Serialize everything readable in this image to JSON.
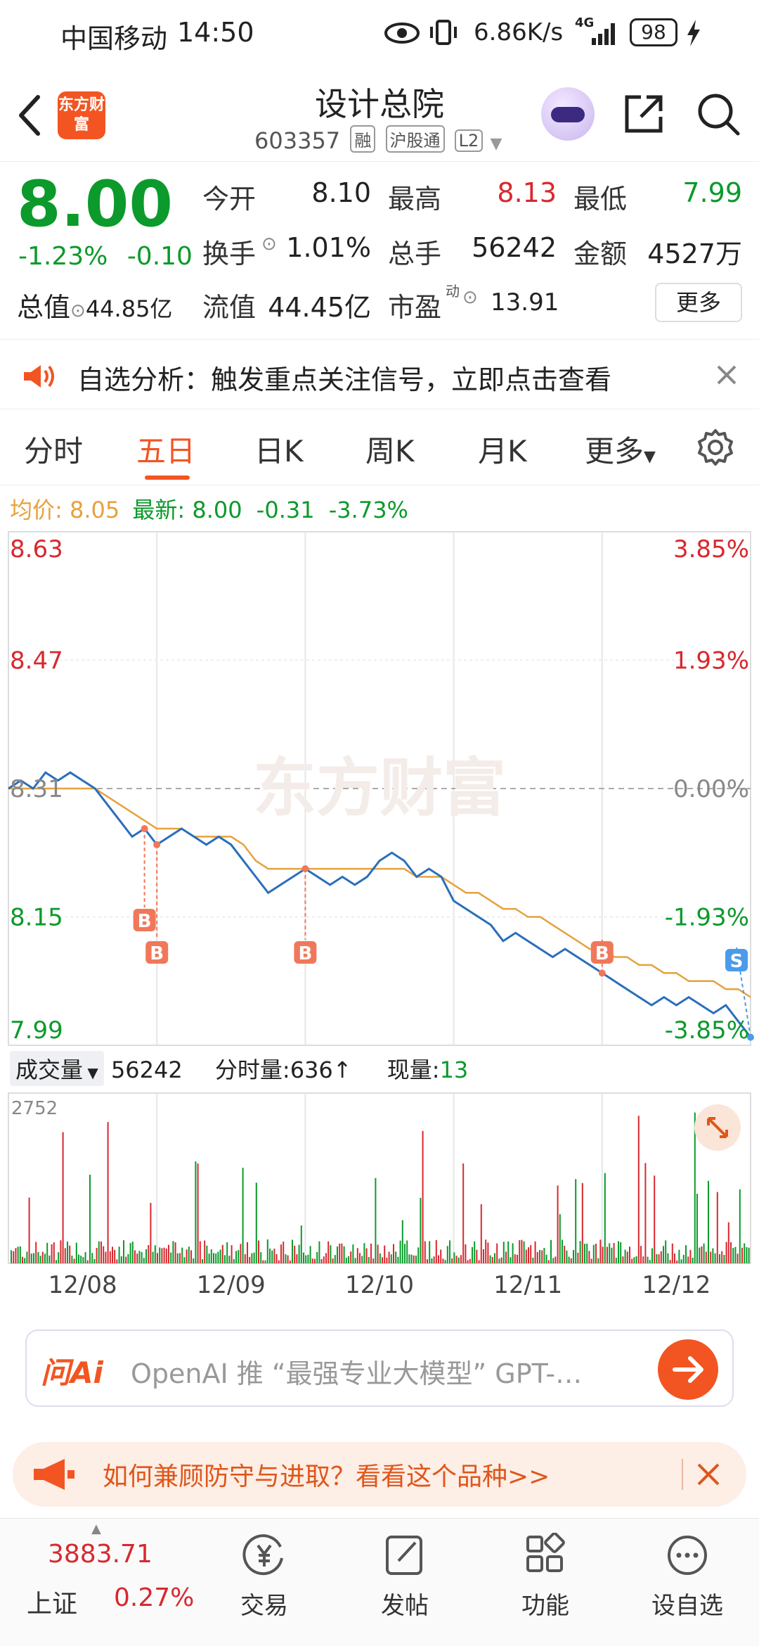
{
  "status_bar": {
    "carrier": "中国移动",
    "time": "14:50",
    "net_speed": "6.86K/s",
    "network": "4G",
    "battery": "98"
  },
  "header": {
    "logo_text": "东方财富",
    "title": "设计总院",
    "code": "603357",
    "tags": [
      "融",
      "沪股通",
      "L2"
    ]
  },
  "quote": {
    "price": "8.00",
    "change_pct": "-1.23%",
    "change": "-0.10",
    "open_label": "今开",
    "open": "8.10",
    "high_label": "最高",
    "high": "8.13",
    "low_label": "最低",
    "low": "7.99",
    "turnover_label": "换手",
    "turnover": "1.01%",
    "volume_label": "总手",
    "volume": "56242",
    "amount_label": "金额",
    "amount": "4527万",
    "total_cap_label": "总值",
    "total_cap": "44.85亿",
    "float_cap_label": "流值",
    "float_cap": "44.45亿",
    "pe_label": "市盈",
    "pe_sup": "动",
    "pe": "13.91",
    "more": "更多"
  },
  "notice": {
    "text": "自选分析：触发重点关注信号，立即点击查看"
  },
  "tabs": [
    "分时",
    "五日",
    "日K",
    "周K",
    "月K",
    "更多"
  ],
  "active_tab": 1,
  "legend": {
    "avg_label": "均价:",
    "avg": "8.05",
    "latest_label": "最新:",
    "latest": "8.00",
    "change": "-0.31",
    "change_pct": "-3.73%"
  },
  "colors": {
    "up": "#d8282e",
    "down": "#0b9a2b",
    "avg": "#e6a23c",
    "price": "#2a6ebb",
    "brand": "#f25522"
  },
  "watermark": "东方财富",
  "chart_data": {
    "type": "line",
    "title": "",
    "y_ticks_left": [
      "8.63",
      "8.47",
      "8.31",
      "8.15",
      "7.99"
    ],
    "y_ticks_right": [
      "3.85%",
      "1.93%",
      "0.00%",
      "-1.93%",
      "-3.85%"
    ],
    "ylim": [
      7.99,
      8.63
    ],
    "x_labels": [
      "12/08",
      "12/09",
      "12/10",
      "12/11",
      "12/12"
    ],
    "series": [
      {
        "values": [
          8.31,
          8.32,
          8.31,
          8.33,
          8.32,
          8.33,
          8.32,
          8.31,
          8.29,
          8.27,
          8.25,
          8.26,
          8.24,
          8.25,
          8.26,
          8.25,
          8.24,
          8.25,
          8.24,
          8.22,
          8.2,
          8.18,
          8.19,
          8.2,
          8.21,
          8.2,
          8.19,
          8.2,
          8.19,
          8.2,
          8.22,
          8.23,
          8.22,
          8.2,
          8.21,
          8.2,
          8.17,
          8.16,
          8.15,
          8.14,
          8.12,
          8.13,
          8.12,
          8.11,
          8.1,
          8.11,
          8.1,
          8.09,
          8.08,
          8.07,
          8.06,
          8.05,
          8.04,
          8.05,
          8.04,
          8.05,
          8.04,
          8.03,
          8.04,
          8.02,
          8.0
        ]
      },
      {
        "values": [
          8.31,
          8.31,
          8.31,
          8.31,
          8.31,
          8.31,
          8.31,
          8.31,
          8.3,
          8.29,
          8.28,
          8.27,
          8.26,
          8.26,
          8.26,
          8.25,
          8.25,
          8.25,
          8.25,
          8.24,
          8.22,
          8.21,
          8.21,
          8.21,
          8.21,
          8.21,
          8.21,
          8.21,
          8.21,
          8.21,
          8.21,
          8.21,
          8.21,
          8.2,
          8.2,
          8.2,
          8.19,
          8.18,
          8.18,
          8.17,
          8.16,
          8.16,
          8.15,
          8.15,
          8.14,
          8.13,
          8.12,
          8.11,
          8.11,
          8.1,
          8.1,
          8.09,
          8.09,
          8.08,
          8.08,
          8.07,
          8.07,
          8.07,
          8.06,
          8.06,
          8.05
        ]
      }
    ],
    "signals": [
      {
        "label": "B",
        "index": 11
      },
      {
        "label": "B",
        "index": 12
      },
      {
        "label": "B",
        "index": 24
      },
      {
        "label": "B",
        "index": 48
      },
      {
        "label": "S",
        "index": 60
      }
    ]
  },
  "volume": {
    "selector": "成交量",
    "total": "56242",
    "tick_vol_label": "分时量:",
    "tick_vol": "636↑",
    "current_label": "现量:",
    "current": "13",
    "max_tick": "2752"
  },
  "ai_bar": {
    "brand": "问Ai",
    "text": "OpenAI 推 “最强专业大模型” GPT-…"
  },
  "ad_bar": {
    "text": "如何兼顾防守与进取？看看这个品种>>"
  },
  "bottom_nav": {
    "index_value": "3883.71",
    "index_name": "上证",
    "index_change": "0.27%",
    "items": [
      "交易",
      "发帖",
      "功能",
      "设自选"
    ]
  }
}
